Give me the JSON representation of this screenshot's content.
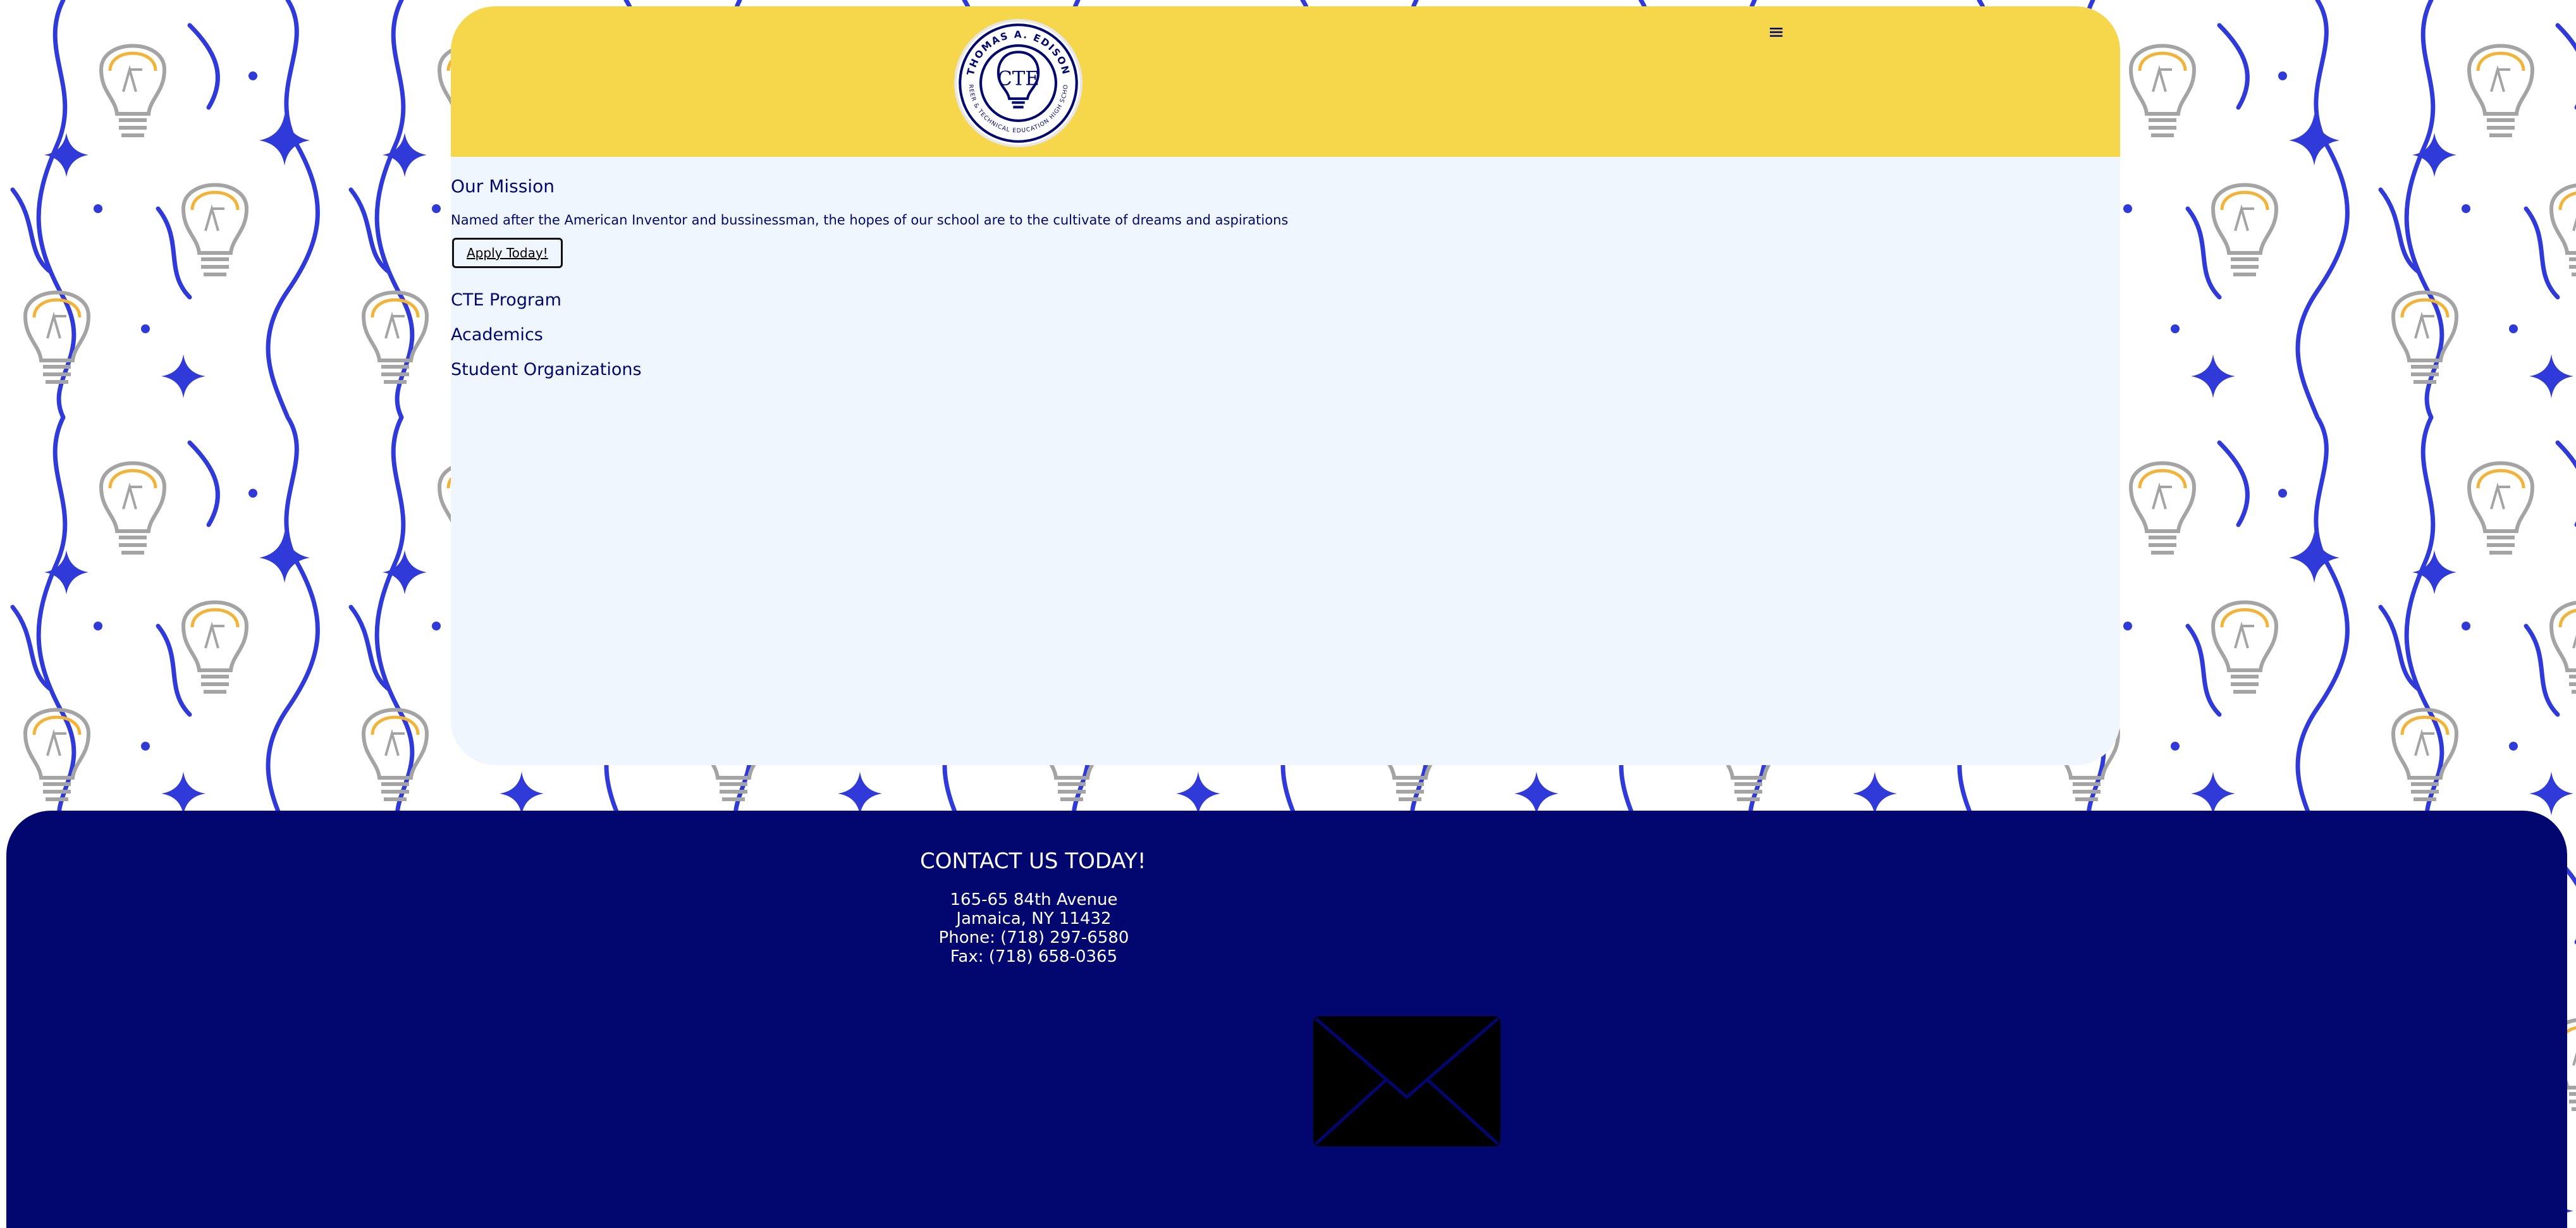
{
  "header": {
    "logo_top_text": "THOMAS A. EDISON",
    "logo_bottom_text": "CAREER & TECHNICAL EDUCATION HIGH SCHOOL",
    "logo_center_text": "CTE",
    "menu_icon": "hamburger-icon",
    "menu_glyph": "≡"
  },
  "main": {
    "mission_title": "Our Mission",
    "mission_text": "Named after the American Inventor and bussinessman, the hopes of our school are to the cultivate of dreams and aspirations",
    "apply_label": "Apply Today!",
    "nav_links": [
      "CTE Program",
      "Academics",
      "Student Organizations"
    ]
  },
  "footer": {
    "contact_title": "CONTACT US TODAY!",
    "address_line1": "165-65 84th Avenue",
    "address_line2": "Jamaica, NY 11432",
    "phone": "Phone: (718) 297-6580",
    "fax": "Fax: (718) 658-0365",
    "mail_icon": "envelope-icon"
  },
  "colors": {
    "header_yellow": "#f6d74c",
    "navy": "#01076f",
    "card_bg": "#eff6fe",
    "pattern_blue": "#2f3ad8",
    "bulb_gray": "#a4a4a4",
    "bulb_yellow": "#f2b338"
  }
}
